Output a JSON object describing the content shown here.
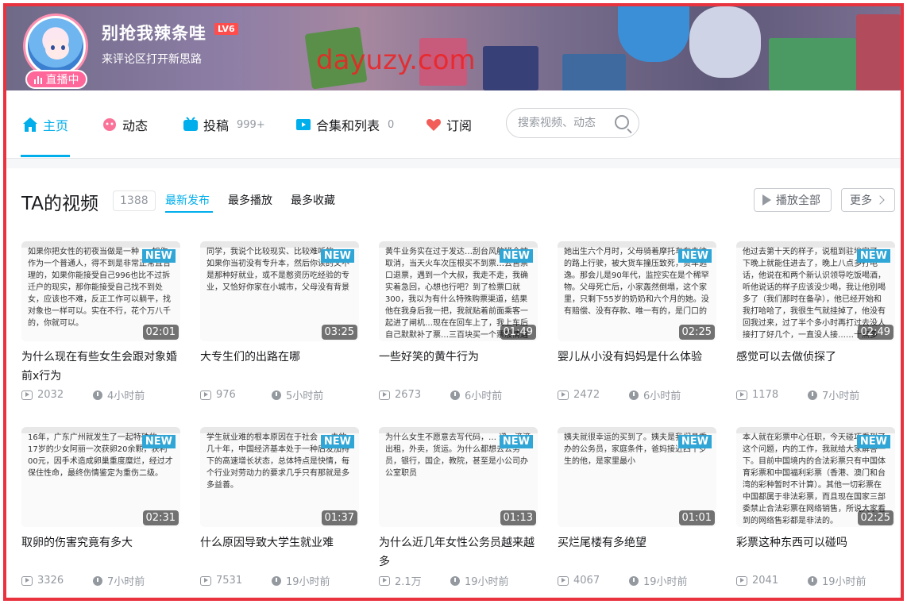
{
  "banner": {
    "username": "别抢我辣条哇",
    "level_badge": "LV6",
    "signature": "来评论区打开新思路",
    "live_label": "直播中",
    "watermark": "dayuzy.com"
  },
  "nav": {
    "home": "主页",
    "dynamic": "动态",
    "videos": "投稿",
    "videos_count": "999+",
    "collections": "合集和列表",
    "collections_count": "0",
    "subscribe": "订阅",
    "search_placeholder": "搜索视频、动态"
  },
  "section": {
    "title": "TA的视频",
    "count": "1388",
    "sort_latest": "最新发布",
    "sort_most_played": "最多播放",
    "sort_most_favorited": "最多收藏",
    "play_all": "播放全部",
    "more": "更多"
  },
  "colors": {
    "accent": "#00aeec",
    "live_pink": "#ff6699",
    "new_badge": "#2fa6d6",
    "frame": "#e8333f"
  },
  "videos": [
    {
      "title": "为什么现在有些女生会跟对象婚前x行为",
      "duration": "02:01",
      "views": "2032",
      "time": "4小时前",
      "badge": "NEW",
      "snippet": "如果你把女性的初夜当做是一种 … 如你作为一个普通人，得不到是非常正常且合理的，如果你能接受自己996也比不过拆迁户的现实，那你能接受自己找不到处女，应该也不难，反正工作可以躺平，找对象也一样可以。实在不行，花个万八千的，你就可以。"
    },
    {
      "title": "大专生们的出路在哪",
      "duration": "03:25",
      "views": "976",
      "time": "5小时前",
      "badge": "NEW",
      "snippet": "同学，我说个比较现实、比较难听的 … 如果你当初没有专升本，然后你读的又不是那种好就业，或不是憨资历吃经验的专业，又恰好你家在小城市，父母没有背景"
    },
    {
      "title": "一些好笑的黄牛行为",
      "duration": "01:49",
      "views": "2673",
      "time": "6小时前",
      "badge": "NEW",
      "snippet": "黄牛业务实在过于发达…刮台风航班全被取消，当天火车次压根买不到票…去售票口退票，遇到一个大叔，我走不走，我确实着急回，心想也行吧？到了检票口就300，我以为有什么特殊购票渠道，结果他在我身后我一把，我就贴着前面乘客一起进了闸机…现在在回车上了，我上车后自己默默补了票…三百块买一个票般情遍到现在都没回过神来。"
    },
    {
      "title": "婴儿从小没有妈妈是什么体验",
      "duration": "02:25",
      "views": "2472",
      "time": "6小时前",
      "badge": "NEW",
      "snippet": "她出生六个月时，父母骑着摩托车在去往的路上行驶，被大货车撞压致死，货车逃逸。那会儿是90年代，监控实在是个稀罕物。父母死亡后，小家轰然倒塌，这个家里，只剩下55岁的奶奶和六个月的她。没有赔偿、没有存款、唯一有的，是门口的"
    },
    {
      "title": "感觉可以去做侦探了",
      "duration": "02:49",
      "views": "1178",
      "time": "7小时前",
      "badge": "NEW",
      "snippet": "他过去第十天的样子，说租到驻地完了一下晚上就能住进去了，晚上八点多打电话，他说在和两个新认识领导吃饭喝酒，听他说话的样子应该没少喝，我让他别喝多了（我们那时在备孕），他已经开始和我打哈哈了，我很生气就挂掉了，他没有回我过来，过了半个多小时再打过去没人接打了好几个，一直没人接……十点多了，还在"
    },
    {
      "title": "取卵的伤害究竟有多大",
      "duration": "02:31",
      "views": "3326",
      "time": "7小时前",
      "badge": "NEW",
      "snippet": "16年，广东广州就发生了一起特殊的，17岁的少女阿丽一次获卵20余颗，获利00元，因手术造成卵巢重度糜烂，经过才保住性命，最终伤情鉴定为重伤二级。"
    },
    {
      "title": "什么原因导致大学生就业难",
      "duration": "01:37",
      "views": "7531",
      "time": "19小时前",
      "badge": "NEW",
      "snippet": "学生就业难的根本原因在于社会 … 去的几十年，中国经济基本处于一种后发加持下的高速增长状态，总体特点是快情，每个行业对劳动力的要求几乎只有那就是多多益善。"
    },
    {
      "title": "为什么近几年女性公务员越来越多",
      "duration": "01:13",
      "views": "2.1万",
      "time": "19小时前",
      "badge": "NEW",
      "snippet": "为什么女生不愿意去写代码，… 递，滴滴出租，外卖，货运。为什么都想去公务员，银行，国企，教院，甚至是小公司办公室职员"
    },
    {
      "title": "买烂尾楼有多绝望",
      "duration": "01:01",
      "views": "4067",
      "time": "19小时前",
      "badge": "NEW",
      "snippet": "姨夫就很幸运的买到了。姨夫是我们县委办的公务员，家庭条件，爸妈接近四十岁生的他，是家里最小"
    },
    {
      "title": "彩票这种东西可以碰吗",
      "duration": "02:25",
      "views": "2041",
      "time": "19小时前",
      "badge": "NEW",
      "snippet": "本人就在彩票中心任职，今天碰巧看到了这个问题，内的工作，我就给大家解答一下。目前中国境内的合法彩票只有中国体育彩票和中国福利彩票（香港、澳门和台湾的彩种暂时不计算）。其他一切彩票在中国都属于非法彩票，而且现在国家三部委禁止合法彩票在网络销售，所说大家看到的网络售彩都是非法的。"
    }
  ]
}
